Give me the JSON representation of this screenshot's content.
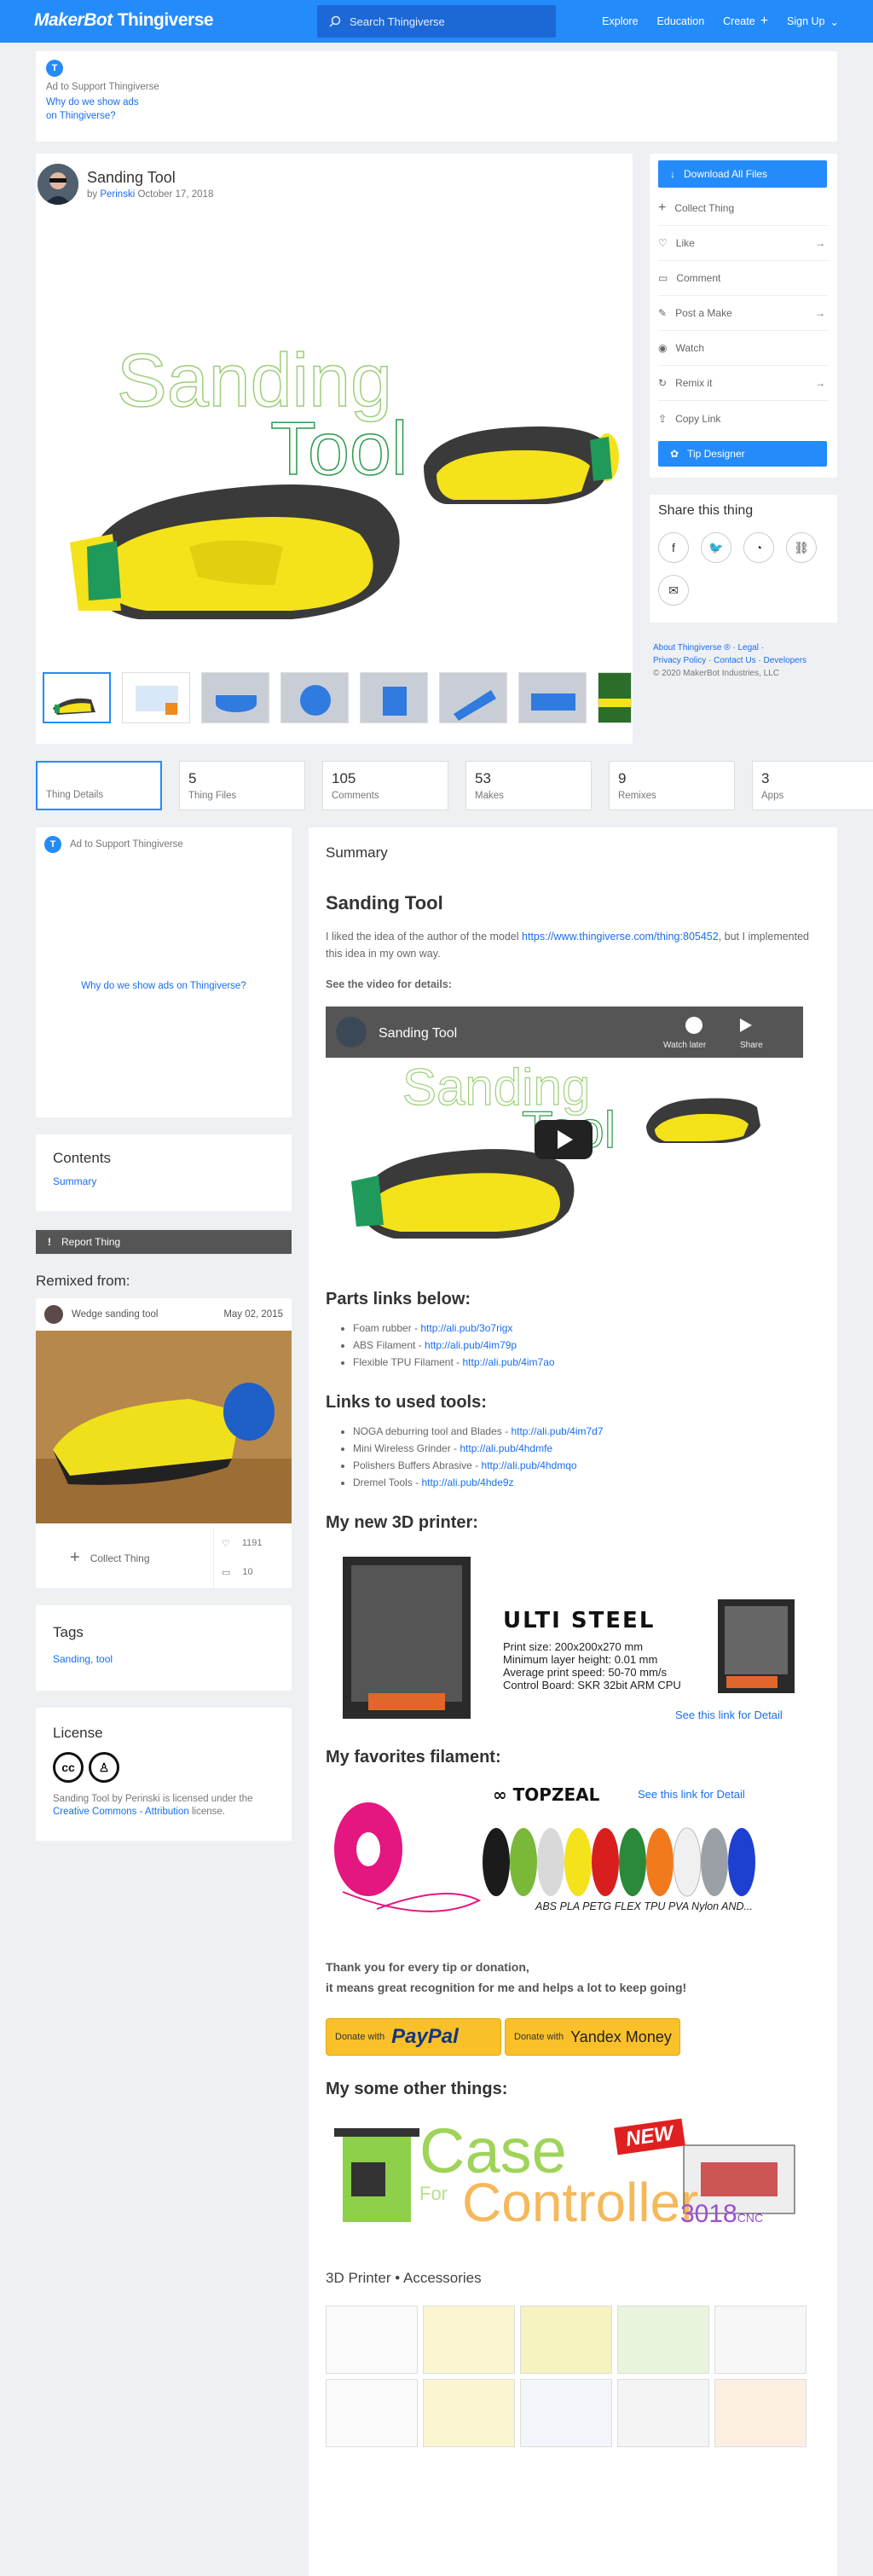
{
  "header": {
    "brand_a": "MakerBot",
    "brand_b": "Thingiverse",
    "search_placeholder": "Search Thingiverse",
    "nav": [
      "Explore",
      "Education",
      "Create",
      "Sign Up"
    ]
  },
  "top_ad": {
    "badge": "T",
    "text": "Ad to Support Thingiverse",
    "link_line1": "Why do we show ads",
    "link_line2": "on Thingiverse?"
  },
  "thing": {
    "title": "Sanding Tool",
    "by": "by",
    "author": "Perinski",
    "date": "October 17, 2018",
    "hero_word1": "Sanding",
    "hero_word2": "Tool"
  },
  "actions": {
    "download": "Download All Files",
    "items": [
      "Collect Thing",
      "Like",
      "Comment",
      "Post a Make",
      "Watch",
      "Remix it",
      "Copy Link"
    ],
    "tip": "Tip Designer"
  },
  "share": {
    "title": "Share this thing"
  },
  "footer": {
    "line1": "About Thingiverse ® · Legal ·",
    "line2": "Privacy Policy · Contact Us · Developers",
    "line3": "© 2020 MakerBot Industries, LLC"
  },
  "tabs": [
    {
      "n": "",
      "l": "Thing Details"
    },
    {
      "n": "5",
      "l": "Thing Files"
    },
    {
      "n": "105",
      "l": "Comments"
    },
    {
      "n": "53",
      "l": "Makes"
    },
    {
      "n": "9",
      "l": "Remixes"
    },
    {
      "n": "3",
      "l": "Apps"
    }
  ],
  "left_ad": {
    "text": "Ad to Support Thingiverse",
    "link": "Why do we show ads on Thingiverse?"
  },
  "contents": {
    "title": "Contents",
    "link": "Summary"
  },
  "report": "Report Thing",
  "remixed": {
    "heading": "Remixed from:",
    "name": "Wedge sanding tool",
    "date": "May 02, 2015",
    "collect": "Collect Thing",
    "likes": "1191",
    "comments": "10"
  },
  "tags": {
    "title": "Tags",
    "text": "Sanding, tool"
  },
  "license": {
    "title": "License",
    "pre": "Sanding Tool by Perinski is licensed under the",
    "link": "Creative Commons - Attribution",
    "post": "license."
  },
  "summary": {
    "label": "Summary",
    "title": "Sanding Tool",
    "p1a": "I liked the idea of the author of the model ",
    "p1link": "https://www.thingiverse.com/thing:805452",
    "p1b": ", but I implemented this idea in my own way.",
    "video_note": "See the video for details:",
    "video_title": "Sanding Tool",
    "watch_later": "Watch later",
    "share": "Share",
    "parts_h": "Parts links below:",
    "parts": [
      [
        "Foam rubber - ",
        "http://ali.pub/3o7rigx"
      ],
      [
        "ABS Filament - ",
        "http://ali.pub/4im79p"
      ],
      [
        "Flexible TPU Filament - ",
        "http://ali.pub/4im7ao"
      ]
    ],
    "tools_h": "Links to used tools:",
    "tools": [
      [
        "NOGA deburring tool and Blades - ",
        "http://ali.pub/4im7d7"
      ],
      [
        "Mini Wireless Grinder - ",
        "http://ali.pub/4hdmfe"
      ],
      [
        "Polishers Buffers Abrasive - ",
        "http://ali.pub/4hdmqo"
      ],
      [
        "Dremel Tools - ",
        "http://ali.pub/4hde9z"
      ]
    ],
    "printer_h": "My new 3D printer:",
    "printer": {
      "name": "ULTI STEEL",
      "l1": "Print size: 200x200x270 mm",
      "l2": "Minimum layer height: 0.01 mm",
      "l3": "Average print speed: 50-70 mm/s",
      "l4": "Control Board: SKR 32bit ARM CPU",
      "link": "See this link for Detail"
    },
    "fil_h": "My favorites filament:",
    "fil": {
      "brand": "TOPZEAL",
      "link": "See this link for Detail",
      "types": "ABS PLA PETG FLEX TPU PVA Nylon AND..."
    },
    "thanks1": "Thank you for every tip or donation,",
    "thanks2": "it means great recognition for me and helps a lot to keep going!",
    "donate1_pre": "Donate with",
    "donate1": "PayPal",
    "donate2_pre": "Donate with",
    "donate2": "Yandex Money",
    "other_h": "My some other things:",
    "case_w1": "Case",
    "case_for": "For",
    "case_w2": "Controller",
    "new": "NEW",
    "cnc": "3018",
    "cnc2": "CNC",
    "acc": "3D Printer • Accessories"
  }
}
